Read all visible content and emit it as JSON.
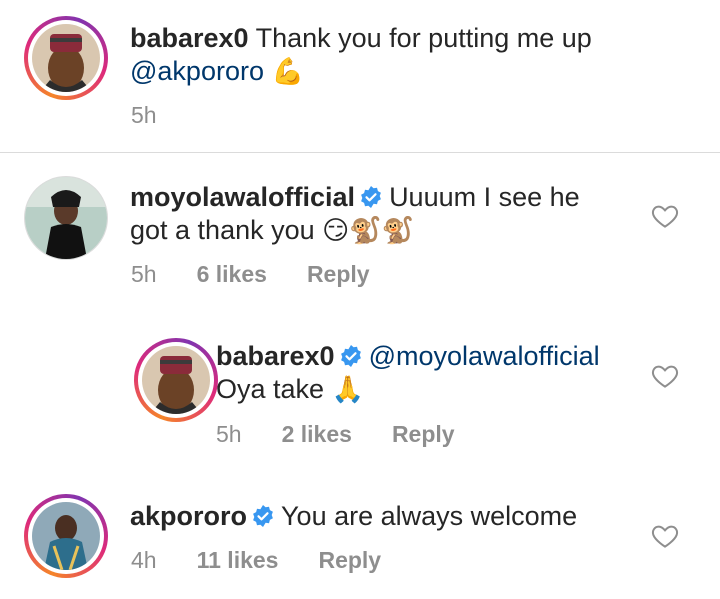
{
  "comments": [
    {
      "username": "babarex0",
      "text": "Thank you for putting me up",
      "mention": "@akpororo",
      "emoji": "💪",
      "time": "5h"
    },
    {
      "username": "moyolawalofficial",
      "text_line1": "Uuuum I see he",
      "text_line2": "got a thank you",
      "emoji": "😏🐒🐒",
      "time": "5h",
      "likes": "6 likes",
      "reply": "Reply"
    },
    {
      "username": "babarex0",
      "mention": "@moyolawalofficial",
      "text": "Oya take",
      "emoji": "🙏",
      "time": "5h",
      "likes": "2 likes",
      "reply": "Reply"
    },
    {
      "username": "akpororo",
      "text": "You are always welcome",
      "time": "4h",
      "likes": "11 likes",
      "reply": "Reply"
    }
  ],
  "colors": {
    "verified_badge": "#3897f0",
    "mention": "#00376b",
    "meta_gray": "#8e8e8e"
  }
}
